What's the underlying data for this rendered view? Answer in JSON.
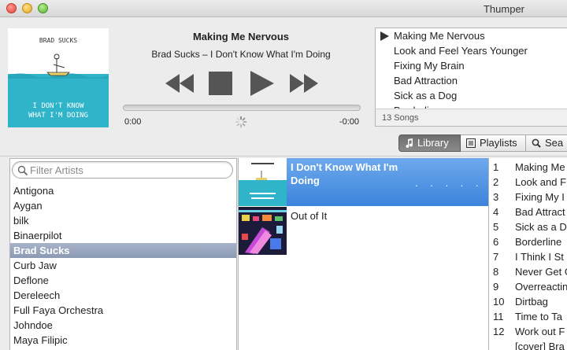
{
  "window": {
    "title": "Thumper"
  },
  "now_playing": {
    "title": "Making Me Nervous",
    "subtitle": "Brad Sucks – I Don't Know What I'm Doing",
    "time_elapsed": "0:00",
    "time_remaining": "-0:00",
    "progress": 0,
    "album_art": {
      "artist_text": "BRAD SUCKS",
      "album_text_1": "I DON'T KNOW",
      "album_text_2": "WHAT I'M DOING"
    }
  },
  "controls": [
    "previous-icon",
    "stop-icon",
    "play-icon",
    "next-icon"
  ],
  "queue": {
    "playing_index": 0,
    "items": [
      {
        "label": "Making Me Nervous"
      },
      {
        "label": "Look and Feel Years Younger"
      },
      {
        "label": "Fixing My Brain"
      },
      {
        "label": "Bad Attraction"
      },
      {
        "label": "Sick as a Dog"
      },
      {
        "label": "Borderline"
      }
    ],
    "count_label": "13 Songs"
  },
  "tabs": [
    {
      "label": "Library",
      "icon": "music-note-icon",
      "active": true
    },
    {
      "label": "Playlists",
      "icon": "playlist-icon",
      "active": false
    },
    {
      "label": "Sea",
      "icon": "search-icon",
      "active": false
    }
  ],
  "artists": {
    "filter_placeholder": "Filter Artists",
    "items": [
      {
        "label": "Antigona"
      },
      {
        "label": "Aygan"
      },
      {
        "label": "bilk"
      },
      {
        "label": "Binaerpilot"
      },
      {
        "label": "Brad Sucks"
      },
      {
        "label": "Curb Jaw"
      },
      {
        "label": "Deflone"
      },
      {
        "label": "Dereleech"
      },
      {
        "label": "Full Faya Orchestra"
      },
      {
        "label": "Johndoe"
      },
      {
        "label": "Maya Filipic"
      }
    ],
    "selected_index": 4
  },
  "albums": {
    "items": [
      {
        "title": "I Don't Know What I'm Doing",
        "dots": ". . . . ."
      },
      {
        "title": "Out of It"
      }
    ],
    "selected_index": 0
  },
  "tracks": {
    "items": [
      {
        "num": "1",
        "title": "Making Me"
      },
      {
        "num": "2",
        "title": "Look and F"
      },
      {
        "num": "3",
        "title": "Fixing My I"
      },
      {
        "num": "4",
        "title": "Bad Attract"
      },
      {
        "num": "5",
        "title": "Sick as a D"
      },
      {
        "num": "6",
        "title": "Borderline"
      },
      {
        "num": "7",
        "title": "I Think I St"
      },
      {
        "num": "8",
        "title": "Never Get G"
      },
      {
        "num": "9",
        "title": "Overreactin"
      },
      {
        "num": "10",
        "title": "Dirtbag"
      },
      {
        "num": "11",
        "title": "Time to Ta"
      },
      {
        "num": "12",
        "title": "Work out F"
      },
      {
        "num": "",
        "title": "[cover] Bra"
      }
    ]
  },
  "colors": {
    "selection_blue": "#3b84dc",
    "artist_selection": "#8b99b4",
    "album_sea": "#2fb4c9"
  }
}
